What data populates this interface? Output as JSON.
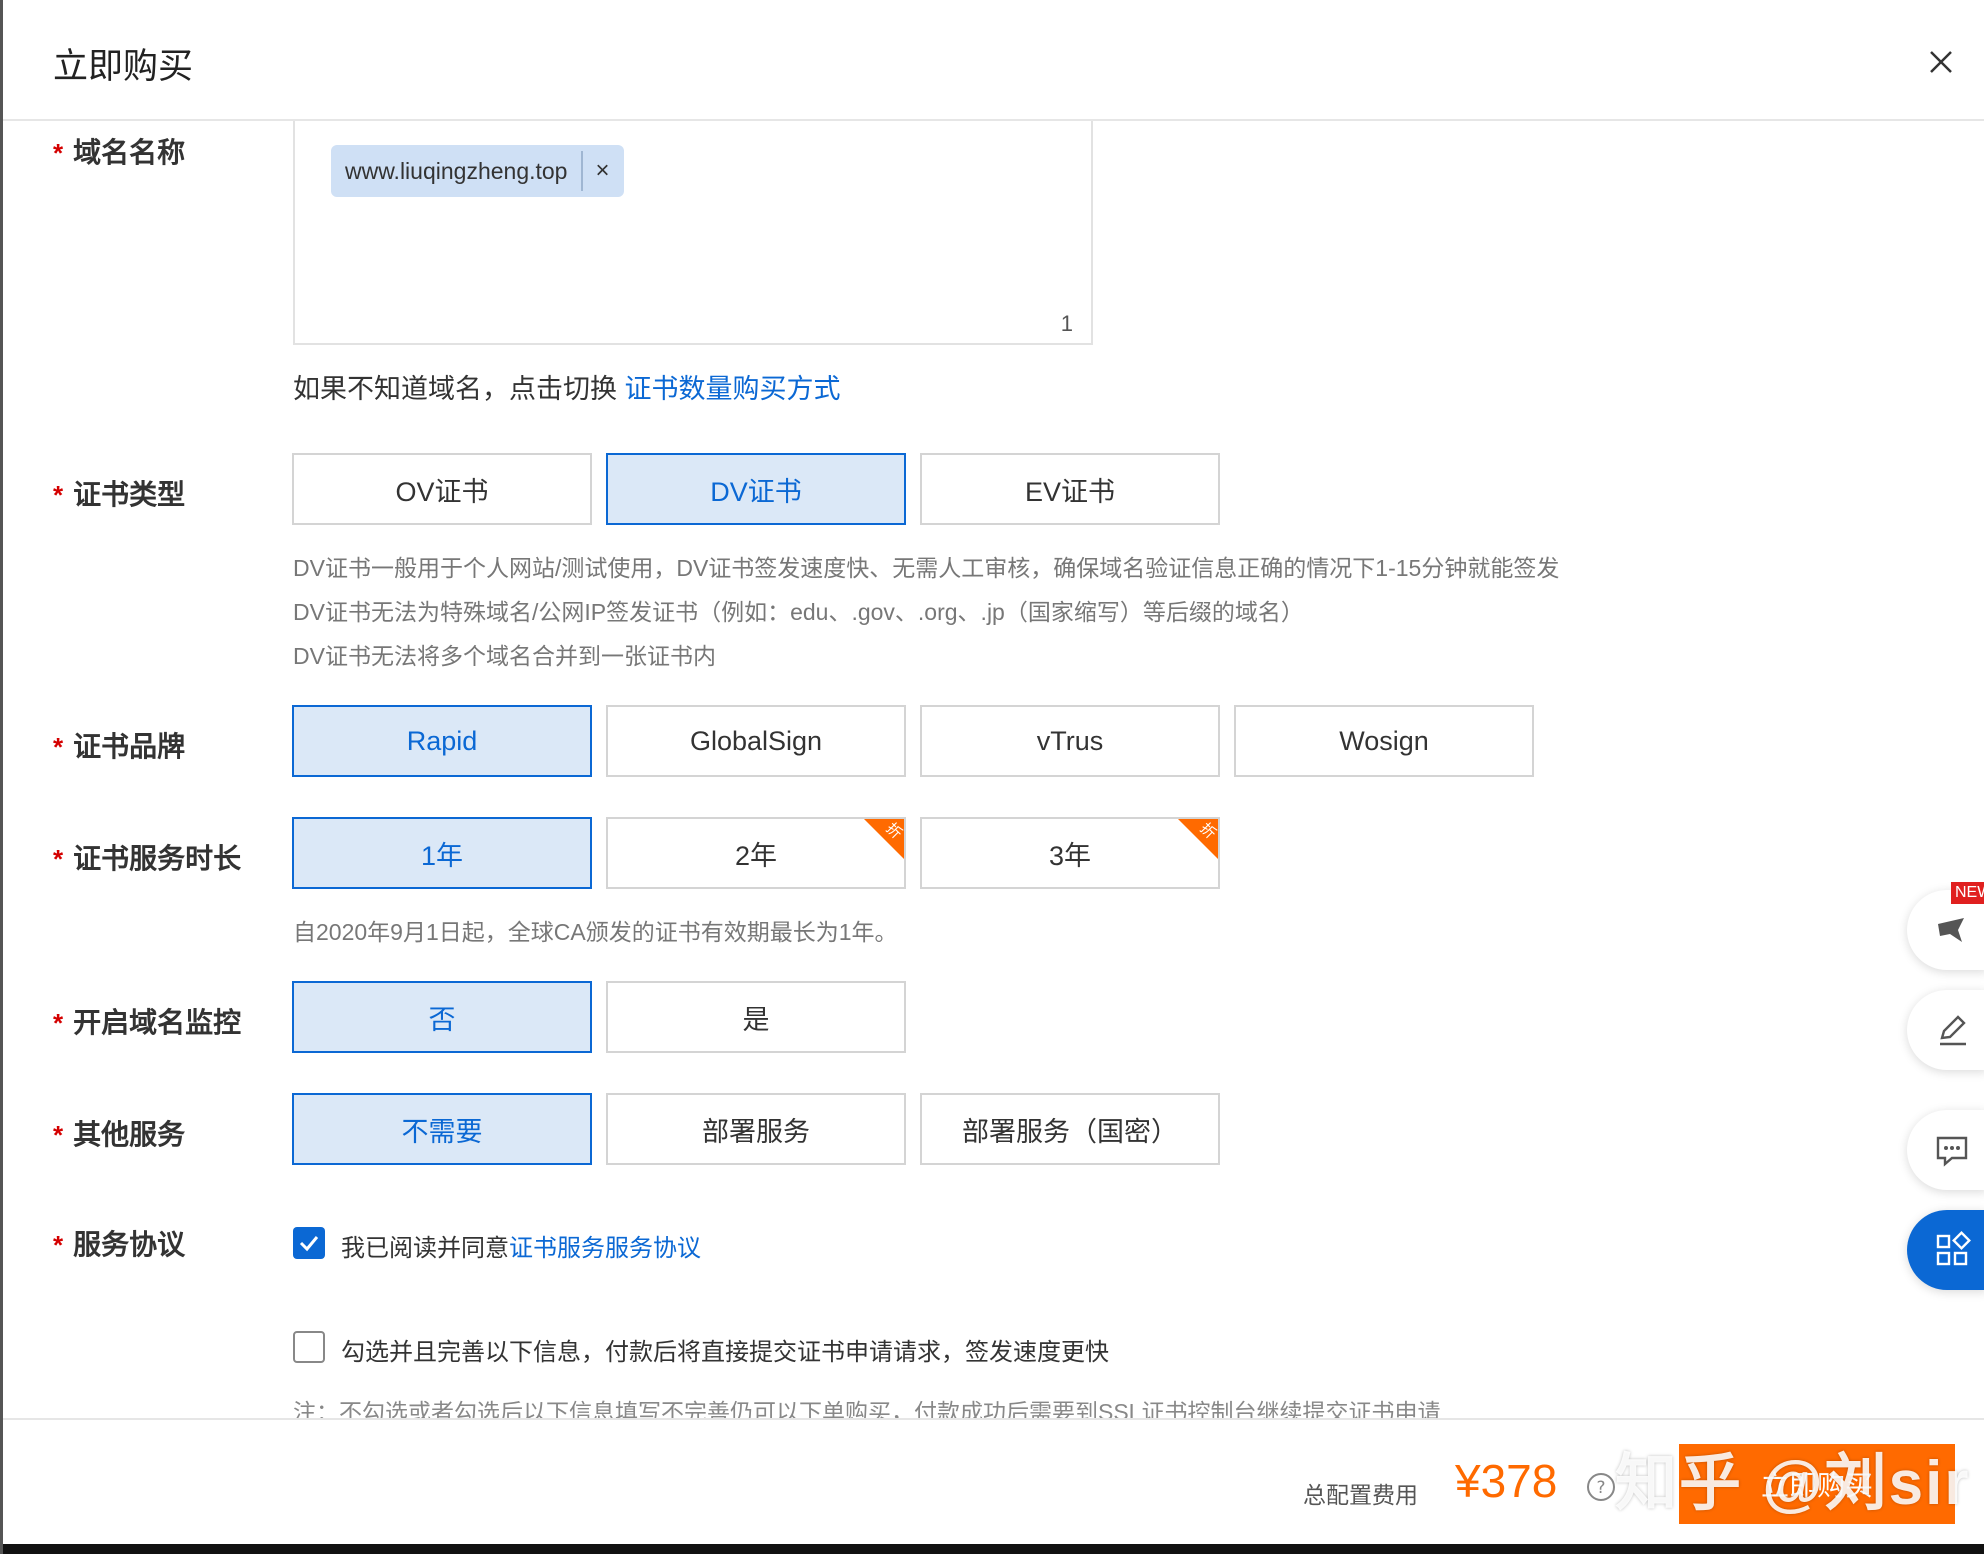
{
  "dialog": {
    "title": "立即购买",
    "close_label": "×"
  },
  "domain": {
    "label": "域名名称",
    "required_mark": "*",
    "tag_value": "www.liuqingzheng.top",
    "tag_remove": "×",
    "count": "1",
    "hint_prefix": "如果不知道域名，点击切换 ",
    "hint_link": "证书数量购买方式"
  },
  "cert_type": {
    "label": "证书类型",
    "required_mark": "*",
    "options": [
      "OV证书",
      "DV证书",
      "EV证书"
    ],
    "selected": "DV证书",
    "desc": [
      "DV证书一般用于个人网站/测试使用，DV证书签发速度快、无需人工审核，确保域名验证信息正确的情况下1-15分钟就能签发",
      "DV证书无法为特殊域名/公网IP签发证书（例如：edu、.gov、.org、.jp（国家缩写）等后缀的域名）",
      "DV证书无法将多个域名合并到一张证书内"
    ]
  },
  "brand": {
    "label": "证书品牌",
    "required_mark": "*",
    "options": [
      "Rapid",
      "GlobalSign",
      "vTrus",
      "Wosign"
    ],
    "selected": "Rapid"
  },
  "duration": {
    "label": "证书服务时长",
    "required_mark": "*",
    "options": [
      "1年",
      "2年",
      "3年"
    ],
    "selected": "1年",
    "discount_badge": "折",
    "desc": "自2020年9月1日起，全球CA颁发的证书有效期最长为1年。"
  },
  "monitor": {
    "label": "开启域名监控",
    "required_mark": "*",
    "options": [
      "否",
      "是"
    ],
    "selected": "否"
  },
  "other": {
    "label": "其他服务",
    "required_mark": "*",
    "options": [
      "不需要",
      "部署服务",
      "部署服务（国密）"
    ],
    "selected": "不需要"
  },
  "agreement": {
    "label": "服务协议",
    "required_mark": "*",
    "checked": true,
    "text": "我已阅读并同意",
    "link": "证书服务服务协议",
    "extra_checked": false,
    "extra_text": "勾选并且完善以下信息，付款后将直接提交证书申请请求，签发速度更快",
    "note": "注：不勾选或者勾选后以下信息填写不完善仍可以下单购买，付款成功后需要到SSL证书控制台继续提交证书申请"
  },
  "footer": {
    "total_label": "总配置费用",
    "price": "¥378",
    "buy_label": "立即购买"
  },
  "side_tools": {
    "new_badge": "NEW",
    "icons": [
      "bird-icon",
      "edit-icon",
      "chat-icon",
      "apps-icon"
    ]
  },
  "watermark": "知乎 @刘sir",
  "colors": {
    "accent": "#0b68d4",
    "price": "#ff6a00",
    "selected_bg": "#dbe8f7",
    "required": "#d40000"
  }
}
